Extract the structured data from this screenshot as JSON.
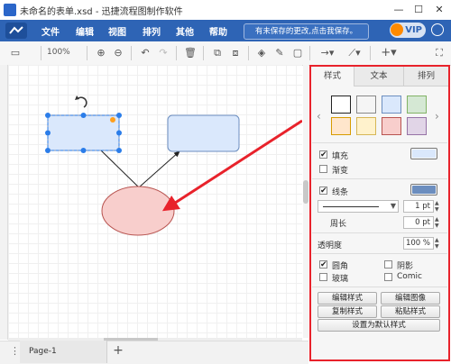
{
  "window": {
    "title": "未命名的表单.xsd - 迅捷流程图制作软件",
    "minimize_glyph": "—",
    "maximize_glyph": "☐",
    "close_glyph": "✕"
  },
  "menu": {
    "items": [
      "文件",
      "编辑",
      "视图",
      "排列",
      "其他",
      "帮助"
    ],
    "unsaved_notice": "有未保存的更改,点击我保存。",
    "vip_label": "VIP"
  },
  "toolbar": {
    "zoom": "100%",
    "icons": [
      "page-view-icon",
      "zoom-in-icon",
      "zoom-out-icon",
      "undo-icon",
      "redo-icon",
      "delete-icon",
      "to-front-icon",
      "to-back-icon",
      "fill-icon",
      "line-color-icon",
      "shadow-icon",
      "connection-icon",
      "waypoint-icon",
      "insert-icon",
      "fullscreen-icon"
    ]
  },
  "canvas": {
    "shapes": [
      {
        "kind": "rounded-rect",
        "fill": "#dae8fc",
        "stroke": "#6c8ebf",
        "selected": true
      },
      {
        "kind": "rounded-rect",
        "fill": "#dae8fc",
        "stroke": "#6c8ebf",
        "selected": false
      },
      {
        "kind": "ellipse",
        "fill": "#f8cecc",
        "stroke": "#b85450",
        "selected": false
      }
    ],
    "annotation_arrow_color": "#e8222b"
  },
  "pages": {
    "current": "Page-1",
    "menu_glyph": "⋮",
    "add_glyph": "+"
  },
  "panel": {
    "tabs": [
      "样式",
      "文本",
      "排列"
    ],
    "active_tab": "样式",
    "swatches": [
      {
        "fill": "#ffffff",
        "stroke": "#222222"
      },
      {
        "fill": "#f5f5f5",
        "stroke": "#888888"
      },
      {
        "fill": "#dae8fc",
        "stroke": "#6c8ebf"
      },
      {
        "fill": "#d5e8d4",
        "stroke": "#82b366"
      },
      {
        "fill": "#ffe6cc",
        "stroke": "#d79b00"
      },
      {
        "fill": "#fff2cc",
        "stroke": "#d6b656"
      },
      {
        "fill": "#f8cecc",
        "stroke": "#b85450"
      },
      {
        "fill": "#e1d5e7",
        "stroke": "#9673a6"
      }
    ],
    "fill": {
      "label": "填充",
      "checked": true,
      "color": "#dae8fc"
    },
    "gradient": {
      "label": "渐变",
      "checked": false
    },
    "line": {
      "label": "线条",
      "checked": true,
      "color": "#6c8ebf",
      "width": "1 pt"
    },
    "perimeter": {
      "label": "周长",
      "value": "0 pt"
    },
    "opacity": {
      "label": "透明度",
      "value": "100 %"
    },
    "options": [
      {
        "label": "圆角",
        "checked": true
      },
      {
        "label": "阴影",
        "checked": false
      },
      {
        "label": "玻璃",
        "checked": false
      },
      {
        "label": "Comic",
        "checked": false
      }
    ],
    "buttons": {
      "edit_style": "编辑样式",
      "edit_image": "编辑图像",
      "copy_style": "复制样式",
      "paste_style": "粘贴样式",
      "set_default": "设置为默认样式"
    }
  }
}
